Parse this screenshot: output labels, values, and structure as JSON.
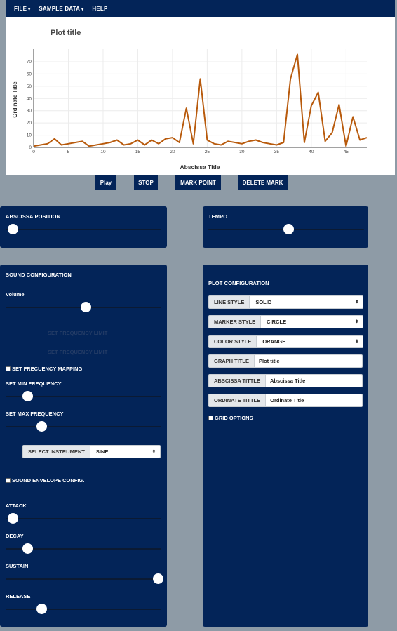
{
  "menu": {
    "file": "FILE",
    "sample_data": "SAMPLE DATA",
    "help": "HELP"
  },
  "controls": {
    "play": "Play",
    "stop": "STOP",
    "mark_point": "MARK POINT",
    "delete_mark": "DELETE MARK"
  },
  "abscissa_panel": {
    "title": "ABSCISSA POSITION",
    "position": 0.0
  },
  "tempo_panel": {
    "title": "TEMPO",
    "value": 0.5
  },
  "sound_config": {
    "title": "SOUND CONFIGURATION",
    "volume_label": "Volume",
    "volume": 0.5,
    "hidden_line1": "SET FREQUENCY LIMIT",
    "hidden_line2": "SET FREQUENCY LIMIT",
    "freq_mapping_label": "SET FRECUENCY MAPPING",
    "min_freq_label": "SET MIN FREQUENCY",
    "min_freq": 0.1,
    "max_freq_label": "SET MAX FREQUENCY",
    "max_freq": 0.2,
    "instrument_label": "SELECT INSTRUMENT",
    "instrument_value": "SINE",
    "envelope_label": "SOUND ENVELOPE CONFIG.",
    "attack_label": "ATTACK",
    "attack": 0.0,
    "decay_label": "DECAY",
    "decay": 0.1,
    "sustain_label": "SUSTAIN",
    "sustain": 1.0,
    "release_label": "RELEASE",
    "release": 0.2
  },
  "plot_config": {
    "title": "PLOT CONFIGURATION",
    "line_style_label": "LINE STYLE",
    "line_style_value": "SOLID",
    "marker_style_label": "MARKER STYLE",
    "marker_style_value": "CIRCLE",
    "color_style_label": "COLOR STYLE",
    "color_style_value": "ORANGE",
    "graph_title_label": "GRAPH TITLE",
    "graph_title_value": "Plot title",
    "abscissa_title_label": "ABSCISSA TITTLE",
    "abscissa_title_value": "Abscissa Title",
    "ordinate_title_label": "ORDINATE TITTLE",
    "ordinate_title_value": "Ordinate Title",
    "grid_options_label": "GRID OPTIONS"
  },
  "colors": {
    "navy": "#032458",
    "line": "#b85a0c"
  },
  "chart_data": {
    "type": "line",
    "title": "Plot title",
    "xlabel": "Abscissa Title",
    "ylabel": "Ordinate Title",
    "xlim": [
      0,
      48
    ],
    "ylim": [
      0,
      78
    ],
    "xticks": [
      0,
      5,
      10,
      15,
      20,
      25,
      30,
      35,
      40,
      45
    ],
    "yticks": [
      0,
      10,
      20,
      30,
      40,
      50,
      60,
      70
    ],
    "grid": true,
    "x": [
      0,
      1,
      2,
      3,
      4,
      5,
      6,
      7,
      8,
      9,
      10,
      11,
      12,
      13,
      14,
      15,
      16,
      17,
      18,
      19,
      20,
      21,
      22,
      23,
      24,
      25,
      26,
      27,
      28,
      29,
      30,
      31,
      32,
      33,
      34,
      35,
      36,
      37,
      38,
      39,
      40,
      41,
      42,
      43,
      44,
      45,
      46,
      47,
      48
    ],
    "y": [
      1,
      2,
      3,
      7,
      2,
      3,
      4,
      5,
      1,
      2,
      3,
      4,
      6,
      2,
      3,
      6,
      2,
      6,
      3,
      7,
      8,
      4,
      32,
      3,
      56,
      6,
      3,
      2,
      5,
      4,
      3,
      5,
      6,
      4,
      3,
      2,
      4,
      56,
      76,
      4,
      34,
      45,
      5,
      12,
      35,
      1,
      25,
      6,
      8
    ]
  }
}
